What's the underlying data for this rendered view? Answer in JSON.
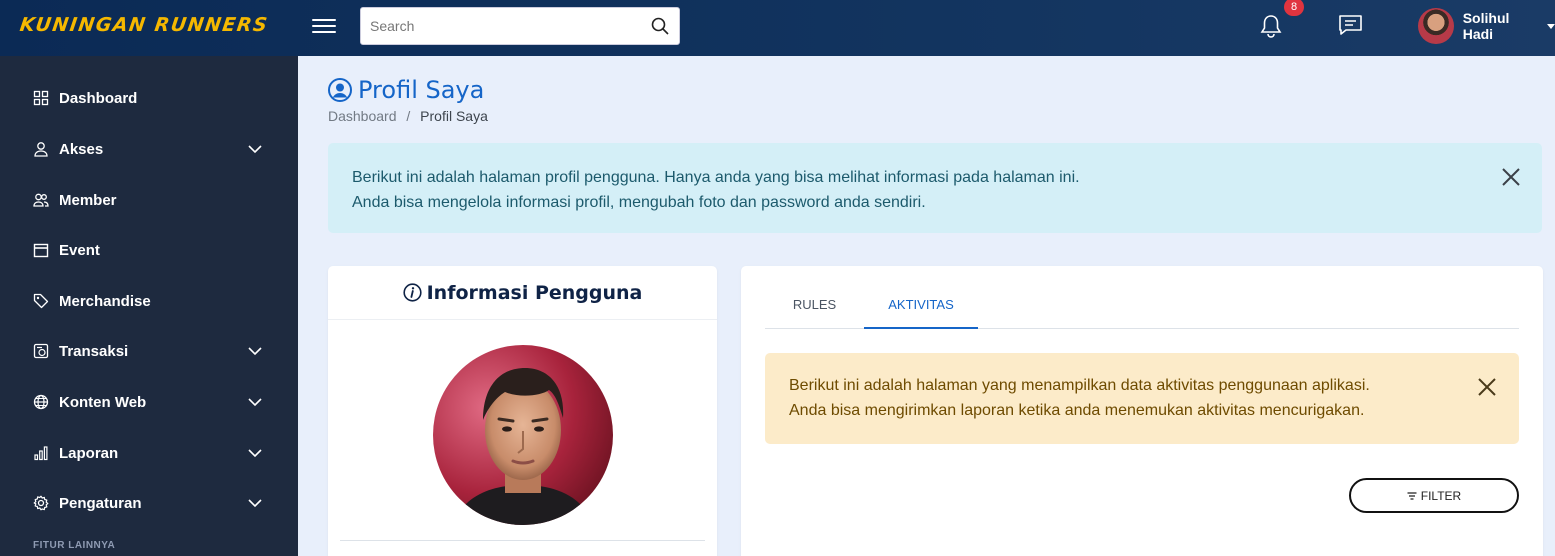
{
  "header": {
    "logo_text": "Kuningan Runners",
    "search_placeholder": "Search",
    "notification_count": "8",
    "user_name": "Solihul Hadi"
  },
  "sidebar": {
    "items": [
      {
        "label": "Dashboard",
        "icon": "grid-icon",
        "expandable": false
      },
      {
        "label": "Akses",
        "icon": "user-icon",
        "expandable": true
      },
      {
        "label": "Member",
        "icon": "users-icon",
        "expandable": false
      },
      {
        "label": "Event",
        "icon": "calendar-icon",
        "expandable": false
      },
      {
        "label": "Merchandise",
        "icon": "tag-icon",
        "expandable": false
      },
      {
        "label": "Transaksi",
        "icon": "receipt-icon",
        "expandable": true
      },
      {
        "label": "Konten Web",
        "icon": "globe-icon",
        "expandable": true
      },
      {
        "label": "Laporan",
        "icon": "bar-chart-icon",
        "expandable": true
      },
      {
        "label": "Pengaturan",
        "icon": "gear-icon",
        "expandable": true
      }
    ],
    "section_label": "FITUR LAINNYA"
  },
  "main": {
    "title": "Profil Saya",
    "breadcrumb": {
      "home": "Dashboard",
      "separator": "/",
      "current": "Profil Saya"
    },
    "info_alert": {
      "line1": "Berikut ini adalah halaman profil pengguna. Hanya anda yang bisa melihat informasi pada halaman ini.",
      "line2": "Anda bisa mengelola informasi profil, mengubah foto dan password anda sendiri."
    },
    "user_card": {
      "title": "Informasi Pengguna"
    },
    "tabs": [
      {
        "label": "RULES",
        "active": false
      },
      {
        "label": "AKTIVITAS",
        "active": true
      }
    ],
    "activity_alert": {
      "line1": "Berikut ini adalah halaman yang menampilkan data aktivitas penggunaan aplikasi.",
      "line2": "Anda bisa mengirimkan laporan ketika anda menemukan aktivitas mencurigakan."
    },
    "filter_label": "FILTER"
  },
  "colors": {
    "header_bg": "#0b2a55",
    "sidebar_bg": "#1e2a3f",
    "accent": "#1565c8",
    "logo": "#f5b800",
    "badge": "#e0343f"
  }
}
